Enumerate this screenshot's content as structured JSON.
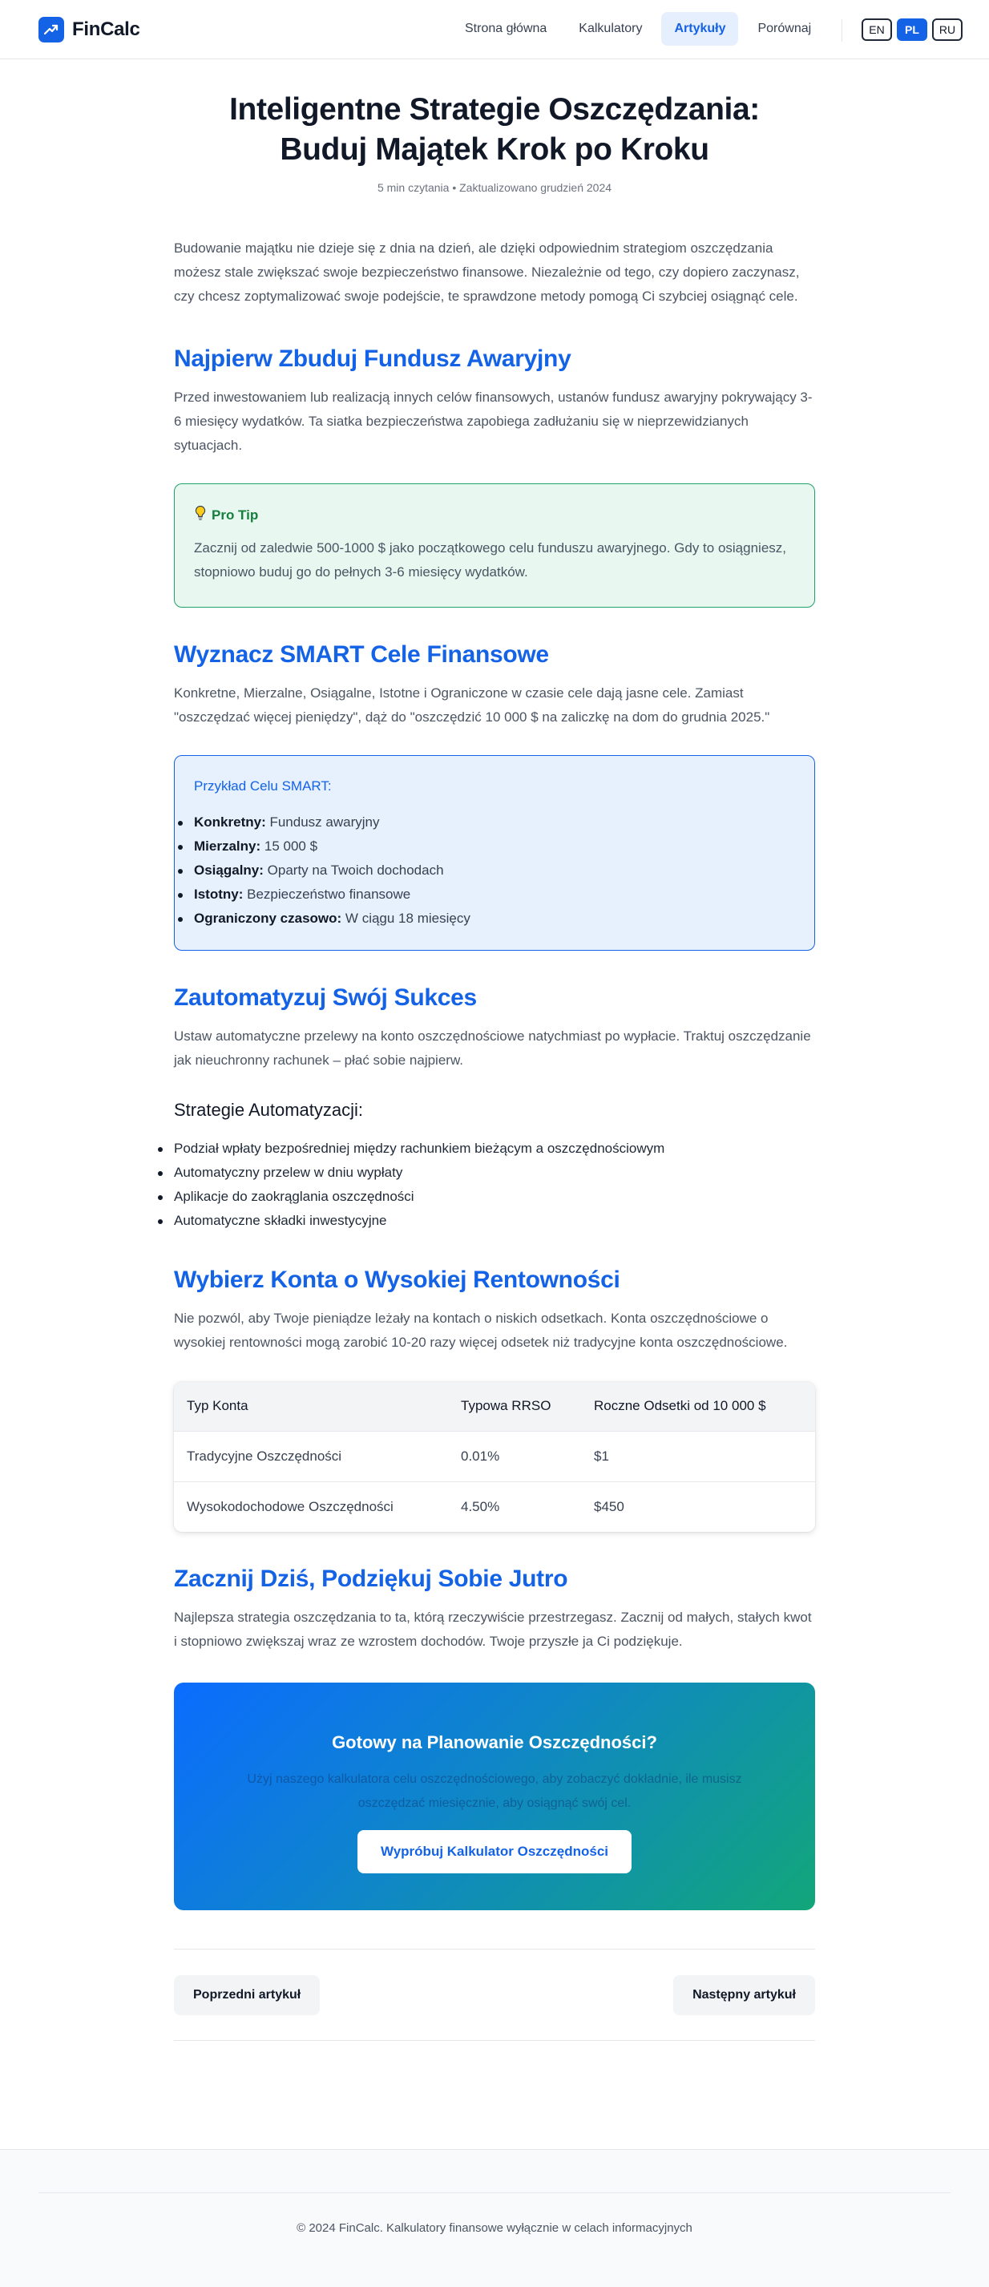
{
  "app": {
    "name": "FinCalc"
  },
  "nav": {
    "items": [
      {
        "label": "Strona główna",
        "active": false
      },
      {
        "label": "Kalkulatory",
        "active": false
      },
      {
        "label": "Artykuły",
        "active": true
      },
      {
        "label": "Porównaj",
        "active": false
      }
    ],
    "languages": [
      {
        "label": "EN",
        "active": false
      },
      {
        "label": "PL",
        "active": true
      },
      {
        "label": "RU",
        "active": false
      }
    ]
  },
  "article": {
    "title_line1": "Inteligentne Strategie Oszczędzania:",
    "title_line2": "Buduj Majątek Krok po Kroku",
    "meta": "5 min czytania • Zaktualizowano grudzień 2024",
    "intro": "Budowanie majątku nie dzieje się z dnia na dzień, ale dzięki odpowiednim strategiom oszczędzania możesz stale zwiększać swoje bezpieczeństwo finansowe. Niezależnie od tego, czy dopiero zaczynasz, czy chcesz zoptymalizować swoje podejście, te sprawdzone metody pomogą Ci szybciej osiągnąć cele.",
    "s1": {
      "heading": "Najpierw Zbuduj Fundusz Awaryjny",
      "text": "Przed inwestowaniem lub realizacją innych celów finansowych, ustanów fundusz awaryjny pokrywający 3-6 miesięcy wydatków. Ta siatka bezpieczeństwa zapobiega zadłużaniu się w nieprzewidzianych sytuacjach.",
      "tip_title": "Pro Tip",
      "tip_text": "Zacznij od zaledwie 500-1000 $ jako początkowego celu funduszu awaryjnego. Gdy to osiągniesz, stopniowo buduj go do pełnych 3-6 miesięcy wydatków."
    },
    "s2": {
      "heading": "Wyznacz SMART Cele Finansowe",
      "text": "Konkretne, Mierzalne, Osiągalne, Istotne i Ograniczone w czasie cele dają jasne cele. Zamiast \"oszczędzać więcej pieniędzy\", dąż do \"oszczędzić 10 000 $ na zaliczkę na dom do grudnia 2025.\"",
      "box_title": "Przykład Celu SMART:",
      "items": [
        {
          "key": "Konkretny:",
          "value": " Fundusz awaryjny"
        },
        {
          "key": "Mierzalny:",
          "value": " 15 000 $"
        },
        {
          "key": "Osiągalny:",
          "value": " Oparty na Twoich dochodach"
        },
        {
          "key": "Istotny:",
          "value": " Bezpieczeństwo finansowe"
        },
        {
          "key": "Ograniczony czasowo:",
          "value": " W ciągu 18 miesięcy"
        }
      ]
    },
    "s3": {
      "heading": "Zautomatyzuj Swój Sukces",
      "text": "Ustaw automatyczne przelewy na konto oszczędnościowe natychmiast po wypłacie. Traktuj oszczędzanie jak nieuchronny rachunek – płać sobie najpierw.",
      "subheading": "Strategie Automatyzacji:",
      "items": [
        "Podział wpłaty bezpośredniej między rachunkiem bieżącym a oszczędnościowym",
        "Automatyczny przelew w dniu wypłaty",
        "Aplikacje do zaokrąglania oszczędności",
        "Automatyczne składki inwestycyjne"
      ]
    },
    "s4": {
      "heading": "Wybierz Konta o Wysokiej Rentowności",
      "text": "Nie pozwól, aby Twoje pieniądze leżały na kontach o niskich odsetkach. Konta oszczędnościowe o wysokiej rentowności mogą zarobić 10-20 razy więcej odsetek niż tradycyjne konta oszczędnościowe.",
      "table": {
        "headers": [
          "Typ Konta",
          "Typowa RRSO",
          "Roczne Odsetki od 10 000 $"
        ],
        "rows": [
          [
            "Tradycyjne Oszczędności",
            "0.01%",
            "$1"
          ],
          [
            "Wysokodochodowe Oszczędności",
            "4.50%",
            "$450"
          ]
        ]
      }
    },
    "s5": {
      "heading": "Zacznij Dziś, Podziękuj Sobie Jutro",
      "text": "Najlepsza strategia oszczędzania to ta, którą rzeczywiście przestrzegasz. Zacznij od małych, stałych kwot i stopniowo zwiększaj wraz ze wzrostem dochodów. Twoje przyszłe ja Ci podziękuje."
    },
    "cta": {
      "title": "Gotowy na Planowanie Oszczędności?",
      "subtitle_line1": "Użyj naszego kalkulatora celu oszczędnościowego, aby zobaczyć dokładnie, ile musisz",
      "subtitle_line2": "oszczędzać miesięcznie, aby osiągnąć swój cel.",
      "button": "Wypróbuj Kalkulator Oszczędności"
    },
    "pager": {
      "prev": "Poprzedni artykuł",
      "next": "Następny artykuł"
    }
  },
  "footer": {
    "text": "© 2024 FinCalc. Kalkulatory finansowe wyłącznie w celach informacyjnych"
  },
  "colors": {
    "accent": "#1463e6",
    "tip_border": "#22a06b",
    "tip_bg": "#e8f7f0",
    "smart_bg": "#e7f0fd"
  }
}
